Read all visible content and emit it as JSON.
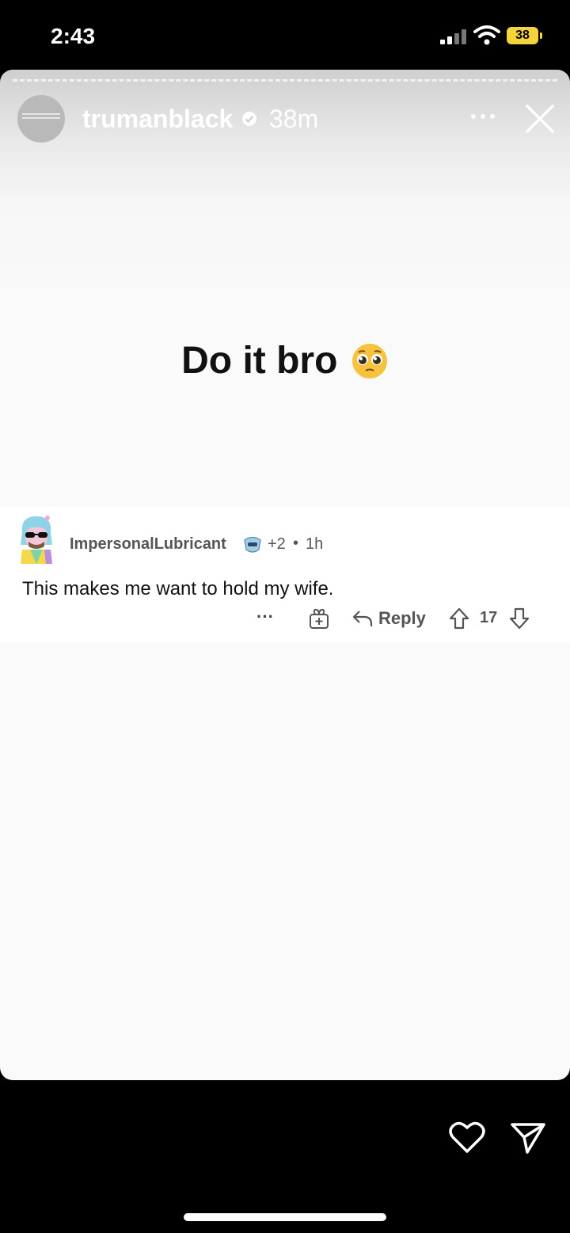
{
  "status_bar": {
    "time": "2:43",
    "battery": "38"
  },
  "story": {
    "username": "trumanblack",
    "time_ago": "38m",
    "headline": "Do it bro",
    "emoji": "pleading-face"
  },
  "comment": {
    "username": "ImpersonalLubricant",
    "extra_awards": "+2",
    "separator": "•",
    "age": "1h",
    "text": "This makes me want to hold my wife.",
    "more_label": "···",
    "reply_label": "Reply",
    "score": "17"
  },
  "colors": {
    "battery": "#f5d33b",
    "story_bg": "#fafafa",
    "text": "#111111"
  }
}
